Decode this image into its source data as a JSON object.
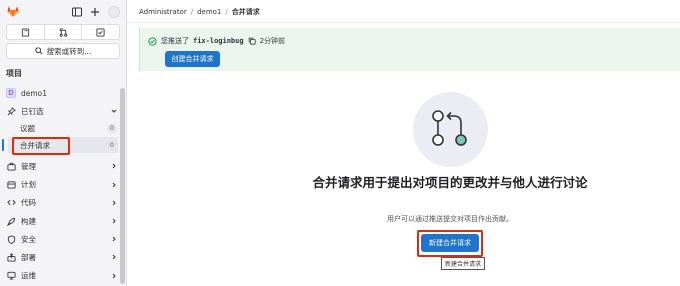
{
  "sidebar": {
    "search_label": "搜索或转到...",
    "section_title": "项目",
    "project": {
      "badge": "D",
      "name": "demo1"
    },
    "pinned": {
      "label": "已钉选",
      "items": [
        {
          "label": "议题",
          "count": "0"
        },
        {
          "label": "合并请求",
          "count": "0"
        }
      ]
    },
    "items": [
      {
        "label": "管理",
        "icon": "briefcase-icon"
      },
      {
        "label": "计划",
        "icon": "calendar-icon"
      },
      {
        "label": "代码",
        "icon": "code-icon"
      },
      {
        "label": "构建",
        "icon": "rocket-icon"
      },
      {
        "label": "安全",
        "icon": "shield-icon"
      },
      {
        "label": "部署",
        "icon": "deploy-icon"
      },
      {
        "label": "运维",
        "icon": "monitor-icon"
      }
    ]
  },
  "breadcrumb": {
    "items": [
      "Administrator",
      "demo1",
      "合并请求"
    ]
  },
  "alert": {
    "prefix": "您推送了",
    "branch": "fix-loginbug",
    "time": "2分钟前",
    "button": "创建合并请求"
  },
  "empty_state": {
    "title": "合并请求用于提出对项目的更改并与他人进行讨论",
    "description": "用户可以通过推送提交对项目作出贡献。",
    "button": "新建合并请求",
    "tooltip": "新建合并请求"
  },
  "colors": {
    "accent": "#1f75cb",
    "highlight": "#dd2b0e",
    "alert_bg": "#ecf4ee",
    "success": "#108548"
  }
}
